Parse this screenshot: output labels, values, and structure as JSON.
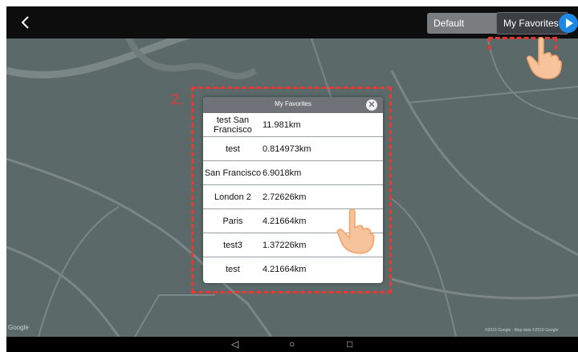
{
  "topbar": {
    "default_routes_label": "Default Routes",
    "my_favorites_label": "My Favorites"
  },
  "annotations": {
    "step_2": "2."
  },
  "dialog": {
    "title": "My Favorites",
    "rows": [
      {
        "name": "test San Francisco",
        "distance": "11.981km"
      },
      {
        "name": "test",
        "distance": "0.814973km"
      },
      {
        "name": "San Francisco",
        "distance": "6.9018km"
      },
      {
        "name": "London 2",
        "distance": "2.72626km"
      },
      {
        "name": "Paris",
        "distance": "4.21664km"
      },
      {
        "name": "test3",
        "distance": "1.37226km"
      },
      {
        "name": "test",
        "distance": "4.21664km"
      }
    ]
  },
  "map": {
    "google_logo": "Google",
    "attribution": "©2016 Google - Map data ©2016 Google"
  },
  "icons": [
    "back-icon",
    "play-icon",
    "close-icon",
    "nav-back-icon",
    "nav-home-icon",
    "nav-recents-icon",
    "hand-pointer-icon"
  ],
  "colors": {
    "accent_red": "#e53935",
    "play_blue": "#1e88e5"
  }
}
